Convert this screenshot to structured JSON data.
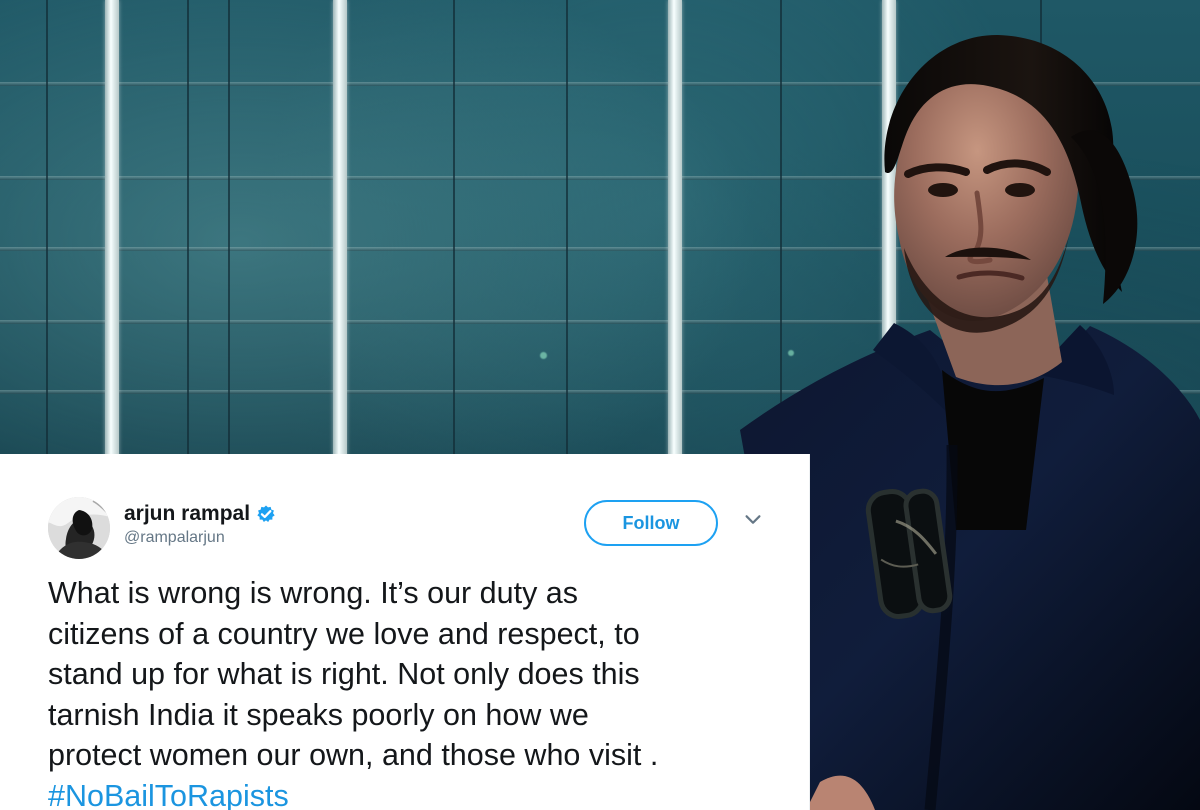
{
  "tweet": {
    "author": {
      "display_name": "arjun rampal",
      "handle": "@rampalarjun",
      "verified": true,
      "avatar_description": "circular black-and-white profile photo"
    },
    "follow_label": "Follow",
    "body_lines": [
      "What is wrong is wrong. It’s our duty as",
      "citizens of a country we love and respect, to",
      "stand up for what is right. Not only does this",
      "tarnish India it speaks poorly on how we",
      "protect women our own, and those who visit ."
    ],
    "hashtag": "#NoBailToRapists"
  },
  "colors": {
    "background_glass": "#184753",
    "tweet_text": "#14171a",
    "handle_text": "#657786",
    "twitter_blue": "#1da1f2",
    "link_blue": "#1b95e0"
  },
  "icons": {
    "verified": "verified-icon",
    "menu": "chevron-down-icon"
  }
}
